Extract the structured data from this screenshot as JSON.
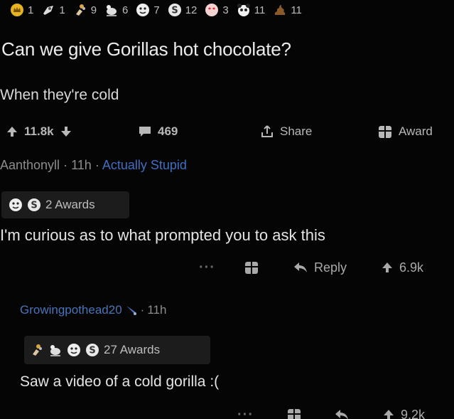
{
  "awards": [
    {
      "icon": "gold-crown-icon",
      "count": "1"
    },
    {
      "icon": "rocket-like-icon",
      "count": "1"
    },
    {
      "icon": "hand-bouquet-icon",
      "count": "9"
    },
    {
      "icon": "pigeon-icon",
      "count": "6"
    },
    {
      "icon": "face-award-icon",
      "count": "7"
    },
    {
      "icon": "silver-s-icon",
      "count": "12"
    },
    {
      "icon": "heart-eyes-icon",
      "count": "3"
    },
    {
      "icon": "panda-icon",
      "count": "11"
    },
    {
      "icon": "poop-icon",
      "count": "11"
    }
  ],
  "post": {
    "title": "Can we give Gorillas hot chocolate?",
    "body": "When they're cold",
    "upvotes": "11.8k",
    "comments": "469",
    "share_label": "Share",
    "award_label": "Award"
  },
  "comment": {
    "author": "Aanthonyll",
    "separator": "·",
    "time": "11h",
    "flair": "Actually Stupid",
    "awards_label": "2 Awards",
    "text": "I'm curious as to what prompted you to ask this",
    "more": "···",
    "reply_label": "Reply",
    "upvotes": "6.9k"
  },
  "reply": {
    "author": "Growingpothead20",
    "separator": "·",
    "time": "11h",
    "awards_label": "27 Awards",
    "text": "Saw a video of a cold gorilla :(",
    "more": "···",
    "upvotes": "9.2k"
  },
  "colors": {
    "background": "#050505",
    "flair": "#3f6fc4",
    "username_link": "#4a73b8",
    "muted": "#8d8d8d"
  }
}
